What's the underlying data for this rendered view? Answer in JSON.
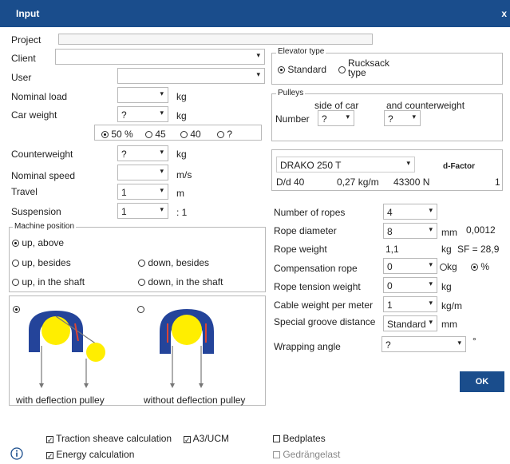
{
  "window": {
    "title": "Input",
    "close": "x"
  },
  "project": {
    "label": "Project",
    "value": ""
  },
  "client": {
    "label": "Client",
    "value": ""
  },
  "user": {
    "label": "User",
    "value": ""
  },
  "nominal_load": {
    "label": "Nominal load",
    "value": "",
    "unit": "kg"
  },
  "car_weight": {
    "label": "Car weight",
    "value": "?",
    "unit": "kg",
    "options": [
      "50 %",
      "45",
      "40",
      "?"
    ],
    "selected_option": "50 %"
  },
  "counterweight": {
    "label": "Counterweight",
    "value": "?",
    "unit": "kg"
  },
  "nominal_speed": {
    "label": "Nominal speed",
    "value": "",
    "unit": "m/s"
  },
  "travel": {
    "label": "Travel",
    "value": "1",
    "unit": "m"
  },
  "suspension": {
    "label": "Suspension",
    "value": "1",
    "unit": ": 1"
  },
  "machine_position": {
    "legend": "Machine position",
    "options": {
      "up_above": "up, above",
      "up_besides": "up, besides",
      "down_besides": "down, besides",
      "up_in_shaft": "up, in the shaft",
      "down_in_shaft": "down, in the shaft"
    },
    "selected": "up, above"
  },
  "deflection": {
    "with": "with deflection pulley",
    "without": "without deflection pulley",
    "selected": "with"
  },
  "elevator_type": {
    "legend": "Elevator type",
    "standard": "Standard",
    "rucksack_1": "Rucksack",
    "rucksack_2": "type",
    "selected": "Standard"
  },
  "pulleys": {
    "legend": "Pulleys",
    "side_of_car": "side of car",
    "and_counterweight": "and counterweight",
    "number_label": "Number",
    "car_value": "?",
    "cw_value": "?"
  },
  "machine": {
    "name": "DRAKO 250 T",
    "d_factor_label": "d-Factor",
    "dd": "D/d 40",
    "rope_kg": "0,27 kg/m",
    "force": "43300  N",
    "d_factor": "1"
  },
  "ropes": {
    "number_of_ropes": {
      "label": "Number of ropes",
      "value": "4"
    },
    "rope_diameter": {
      "label": "Rope diameter",
      "value": "8",
      "unit": "mm",
      "extra": "0,0012"
    },
    "rope_weight": {
      "label": "Rope weight",
      "value": "1,1",
      "unit": "kg",
      "sf": "SF = 28,9"
    },
    "compensation_rope": {
      "label": "Compensation rope",
      "value": "0",
      "opt_kg": "kg",
      "opt_pct": "%",
      "selected": "%"
    },
    "rope_tension_weight": {
      "label": "Rope tension weight",
      "value": "0",
      "unit": "kg"
    },
    "cable_weight": {
      "label": "Cable weight per meter",
      "value": "1",
      "unit": "kg/m"
    },
    "special_groove": {
      "label": "Special groove distance",
      "value": "Standard",
      "unit": "mm"
    },
    "wrapping_angle": {
      "label": "Wrapping angle",
      "value": "?",
      "unit": "°"
    }
  },
  "ok_label": "OK",
  "checks": {
    "traction": {
      "label": "Traction sheave calculation",
      "checked": true
    },
    "a3": {
      "label": "A3/UCM",
      "checked": true
    },
    "bedplates": {
      "label": "Bedplates",
      "checked": false
    },
    "energy": {
      "label": "Energy calculation",
      "checked": true
    },
    "gedraenge": {
      "label": "Gedrängelast",
      "checked": false
    }
  },
  "colors": {
    "title_bar": "#1a4d8c",
    "yellow": "#ffee00",
    "machine_blue": "#24449a"
  },
  "icons": {
    "info": "info-icon",
    "dropdown": "chevron-down-icon"
  }
}
